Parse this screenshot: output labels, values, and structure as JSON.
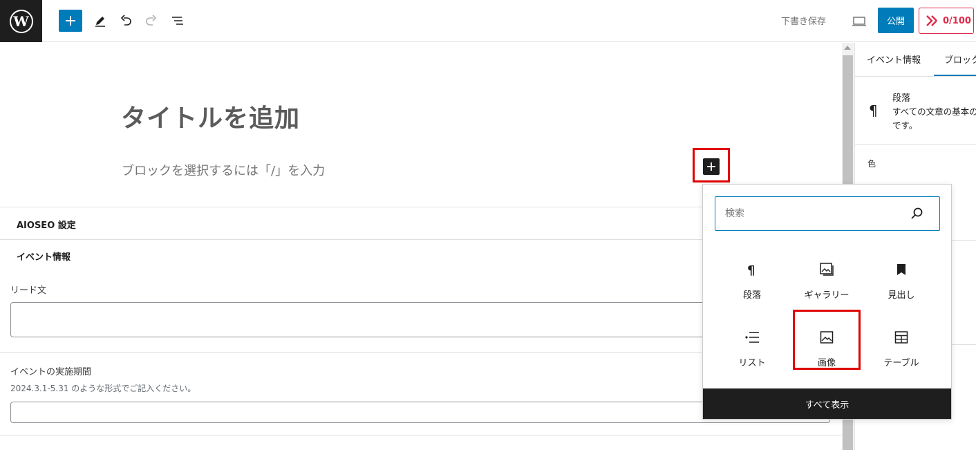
{
  "toolbar": {
    "save_draft": "下書き保存",
    "publish": "公開",
    "score": "0/100"
  },
  "editor": {
    "title_placeholder": "タイトルを追加",
    "block_placeholder": "ブロックを選択するには「/」を入力"
  },
  "meta": {
    "aioseo_title": "AIOSEO 設定",
    "event_title": "イベント情報",
    "lead_label": "リード文",
    "period_label": "イベントの実施期間",
    "period_help": "2024.3.1-5.31 のような形式でご記入ください。"
  },
  "sidebar": {
    "tabs": [
      "イベント情報",
      "ブロック"
    ],
    "block_name": "段落",
    "block_desc_1": "すべての文章の基本の",
    "block_desc_2": "です。",
    "color_label": "色"
  },
  "inserter": {
    "search_placeholder": "検索",
    "blocks": [
      {
        "label": "段落",
        "icon": "paragraph-icon"
      },
      {
        "label": "ギャラリー",
        "icon": "gallery-icon"
      },
      {
        "label": "見出し",
        "icon": "heading-icon"
      },
      {
        "label": "リスト",
        "icon": "list-icon"
      },
      {
        "label": "画像",
        "icon": "image-icon"
      },
      {
        "label": "テーブル",
        "icon": "table-icon"
      }
    ],
    "show_all": "すべて表示"
  },
  "colors": {
    "accent": "#007cba",
    "highlight": "#e00000",
    "score": "#df2a4a",
    "dark": "#1e1e1e"
  }
}
